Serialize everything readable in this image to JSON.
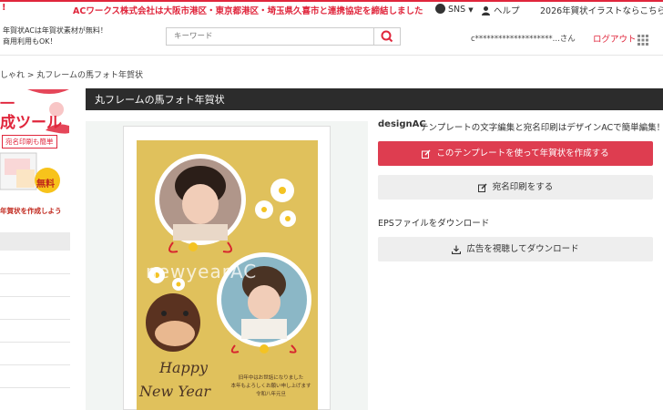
{
  "topbar": {
    "left_mark": "!",
    "announcement": "ACワークス株式会社は大阪市港区・東京都港区・埼玉県久喜市と連携協定を締結しました",
    "sns_label": "SNS",
    "help_label": "ヘルプ",
    "promo_link": "2026年賀状イラストならこちらも！"
  },
  "header": {
    "promo_line1": "年賀状ACは年賀状素材が無料！",
    "promo_line2": "商用利用もOK！",
    "search_placeholder": "キーワード",
    "user_name": "c********************...さん",
    "logout": "ログアウト"
  },
  "breadcrumb": "しゃれ > 丸フレームの馬フォト年賀状",
  "sidebar": {
    "banner_line1": "一",
    "banner_line2": "成ツール",
    "banner_tag": "宛名印刷も簡単",
    "banner_free": "無料",
    "banner_cta": "年賀状を作成しよう"
  },
  "main": {
    "title": "丸フレームの馬フォト年賀状",
    "card": {
      "watermark": "newyearAC",
      "greeting_line1": "Happy",
      "greeting_line2": "New Year",
      "message_line1": "旧年中はお世話になりました",
      "message_line2": "本年もよろしくお願い申し上げます",
      "message_line3": "令和八年元旦"
    }
  },
  "right_panel": {
    "design_logo": "designAC",
    "design_text": "テンプレートの文字編集と宛名印刷はデザインACで簡単編集！",
    "create_button": "このテンプレートを使って年賀状を作成する",
    "address_button": "宛名印刷をする",
    "eps_label": "EPSファイルをダウンロード",
    "download_button": "広告を視聴してダウンロード"
  },
  "colors": {
    "accent": "#e0263c",
    "button_red": "#de3d50",
    "title_bar": "#2c2c2c",
    "card_bg": "#e0c15c"
  }
}
